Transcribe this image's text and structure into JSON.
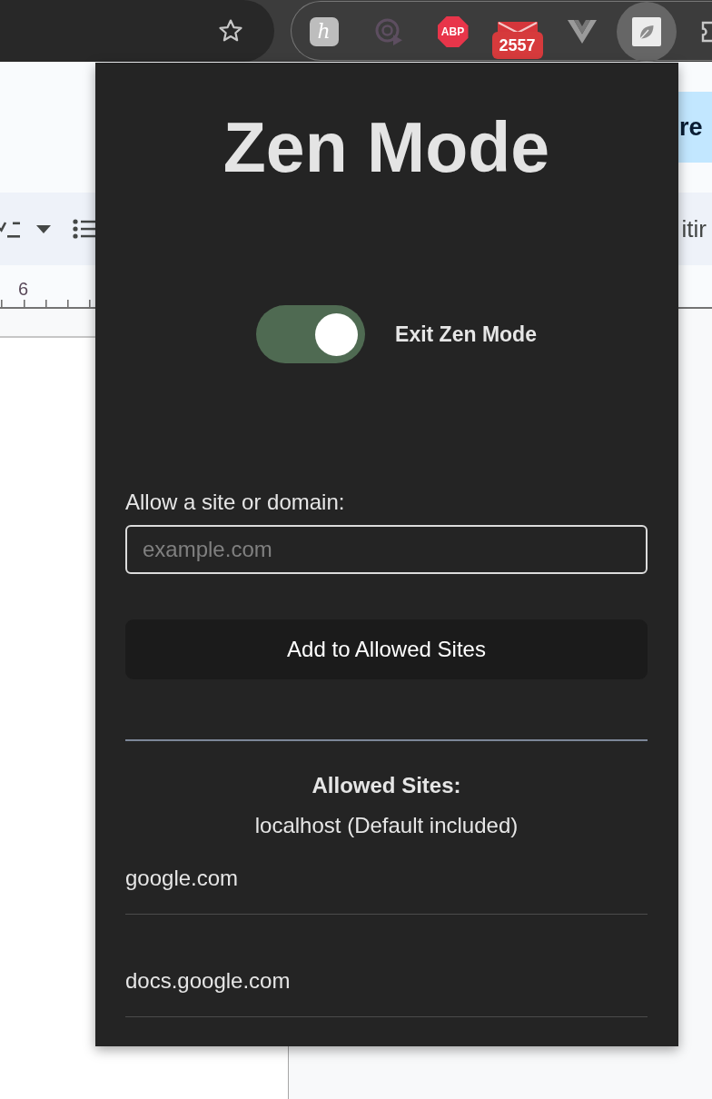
{
  "browser": {
    "extensions": [
      {
        "kind": "letter",
        "label": "h",
        "selected": false
      },
      {
        "kind": "disc",
        "selected": false
      },
      {
        "kind": "stop",
        "label": "ABP",
        "selected": false
      },
      {
        "kind": "mail",
        "badge": "2557",
        "selected": false
      },
      {
        "kind": "vee",
        "selected": false
      },
      {
        "kind": "leaf",
        "selected": true
      },
      {
        "kind": "puzzle",
        "selected": false
      }
    ]
  },
  "document": {
    "share_button": "re",
    "mode_label": "itir",
    "ruler_number": "6"
  },
  "popup": {
    "title": "Zen Mode",
    "toggle": {
      "on": true,
      "label": "Exit Zen Mode"
    },
    "allow_form": {
      "label": "Allow a site or domain:",
      "placeholder": "example.com",
      "button": "Add to Allowed Sites"
    },
    "allowed": {
      "heading": "Allowed Sites:",
      "default_site": "localhost (Default included)",
      "sites": [
        "google.com",
        "docs.google.com"
      ]
    }
  }
}
